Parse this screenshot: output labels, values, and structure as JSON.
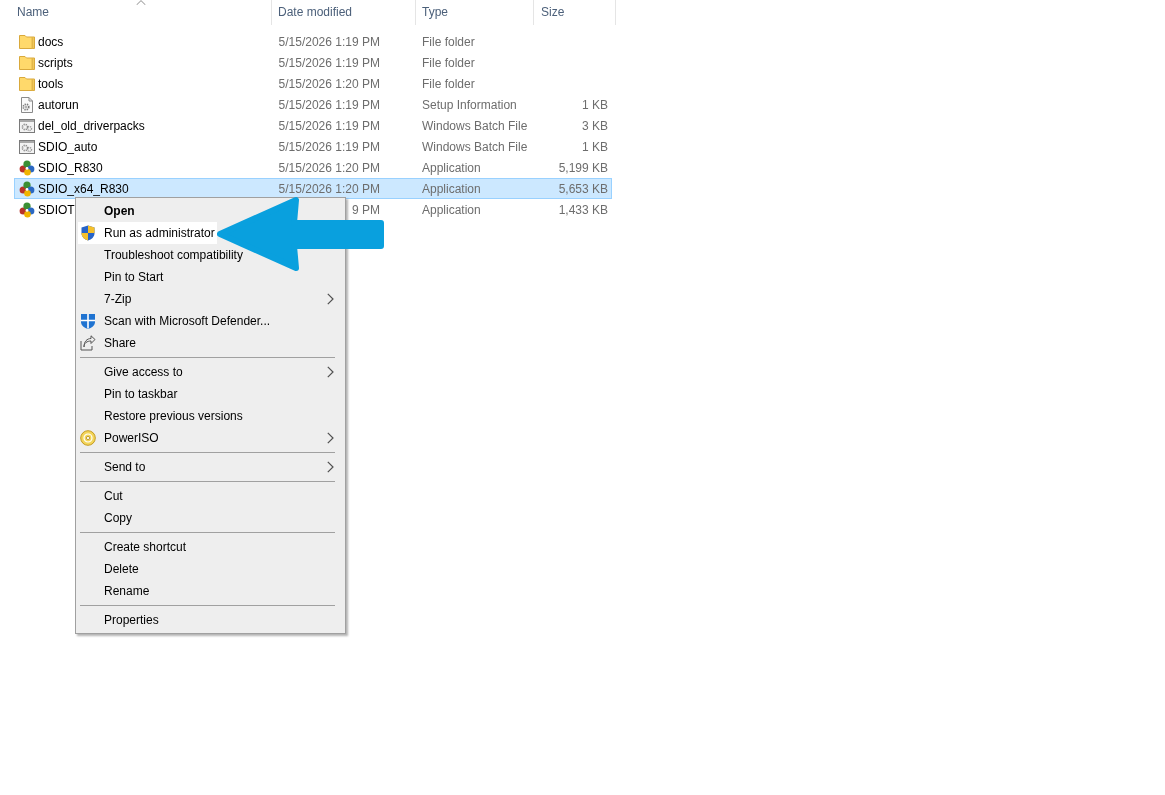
{
  "file_list": {
    "columns": [
      {
        "label": "Name",
        "sorted": true
      },
      {
        "label": "Date modified",
        "sorted": false
      },
      {
        "label": "Type",
        "sorted": false
      },
      {
        "label": "Size",
        "sorted": false
      }
    ],
    "files": [
      {
        "name": "docs",
        "kind": "folder",
        "date": "5/15/2026 1:19 PM",
        "type": "File folder",
        "selected": false
      },
      {
        "name": "scripts",
        "kind": "folder",
        "date": "5/15/2026 1:19 PM",
        "type": "File folder",
        "selected": false
      },
      {
        "name": "tools",
        "kind": "folder",
        "date": "5/15/2026 1:20 PM",
        "type": "File folder",
        "selected": false
      },
      {
        "name": "autorun",
        "kind": "setup",
        "date": "5/15/2026 1:19 PM",
        "type": "Setup Information",
        "size": "1 KB",
        "selected": false
      },
      {
        "name": "del_old_driverpacks",
        "kind": "batch",
        "date": "5/15/2026 1:19 PM",
        "type": "Windows Batch File",
        "size": "3 KB",
        "selected": false
      },
      {
        "name": "SDIO_auto",
        "kind": "batch",
        "date": "5/15/2026 1:19 PM",
        "type": "Windows Batch File",
        "size": "1 KB",
        "selected": false
      },
      {
        "name": "SDIO_R830",
        "kind": "app",
        "date": "5/15/2026 1:20 PM",
        "type": "Application",
        "size": "5,199 KB",
        "selected": false
      },
      {
        "name": "SDIO_x64_R830",
        "kind": "app",
        "date": "5/15/2026 1:20 PM",
        "type": "Application",
        "size": "5,653 KB",
        "selected": true
      },
      {
        "name": "SDIOT",
        "kind": "app",
        "date": "9 PM",
        "type": "Application",
        "size": "1,433 KB",
        "selected": false
      }
    ]
  },
  "context_menu": {
    "groups": [
      [
        {
          "label": "Open",
          "kind": "plain",
          "default": true,
          "submenu": false,
          "selected": false
        },
        {
          "label": "Run as administrator",
          "kind": "shield",
          "default": false,
          "submenu": false,
          "selected": true
        },
        {
          "label": "Troubleshoot compatibility",
          "kind": "plain",
          "default": false,
          "submenu": false,
          "selected": false
        },
        {
          "label": "Pin to Start",
          "kind": "plain",
          "default": false,
          "submenu": false,
          "selected": false
        },
        {
          "label": "7-Zip",
          "kind": "plain",
          "default": false,
          "submenu": true,
          "selected": false
        },
        {
          "label": "Scan with Microsoft Defender...",
          "kind": "scanner",
          "default": false,
          "submenu": false,
          "selected": false
        },
        {
          "label": "Share",
          "kind": "share",
          "default": false,
          "submenu": false,
          "selected": false
        }
      ],
      [
        {
          "label": "Give access to",
          "kind": "plain",
          "default": false,
          "submenu": true,
          "selected": false
        },
        {
          "label": "Pin to taskbar",
          "kind": "plain",
          "default": false,
          "submenu": false,
          "selected": false
        },
        {
          "label": "Restore previous versions",
          "kind": "plain",
          "default": false,
          "submenu": false,
          "selected": false
        },
        {
          "label": "PowerISO",
          "kind": "disc",
          "default": false,
          "submenu": true,
          "selected": false
        }
      ],
      [
        {
          "label": "Send to",
          "kind": "plain",
          "default": false,
          "submenu": true,
          "selected": false
        }
      ],
      [
        {
          "label": "Cut",
          "kind": "plain",
          "default": false,
          "submenu": false,
          "selected": false
        },
        {
          "label": "Copy",
          "kind": "plain",
          "default": false,
          "submenu": false,
          "selected": false
        }
      ],
      [
        {
          "label": "Create shortcut",
          "kind": "plain",
          "default": false,
          "submenu": false,
          "selected": false
        },
        {
          "label": "Delete",
          "kind": "plain",
          "default": false,
          "submenu": false,
          "selected": false
        },
        {
          "label": "Rename",
          "kind": "plain",
          "default": false,
          "submenu": false,
          "selected": false
        }
      ],
      [
        {
          "label": "Properties",
          "kind": "plain",
          "default": false,
          "submenu": false,
          "selected": false
        }
      ]
    ]
  }
}
